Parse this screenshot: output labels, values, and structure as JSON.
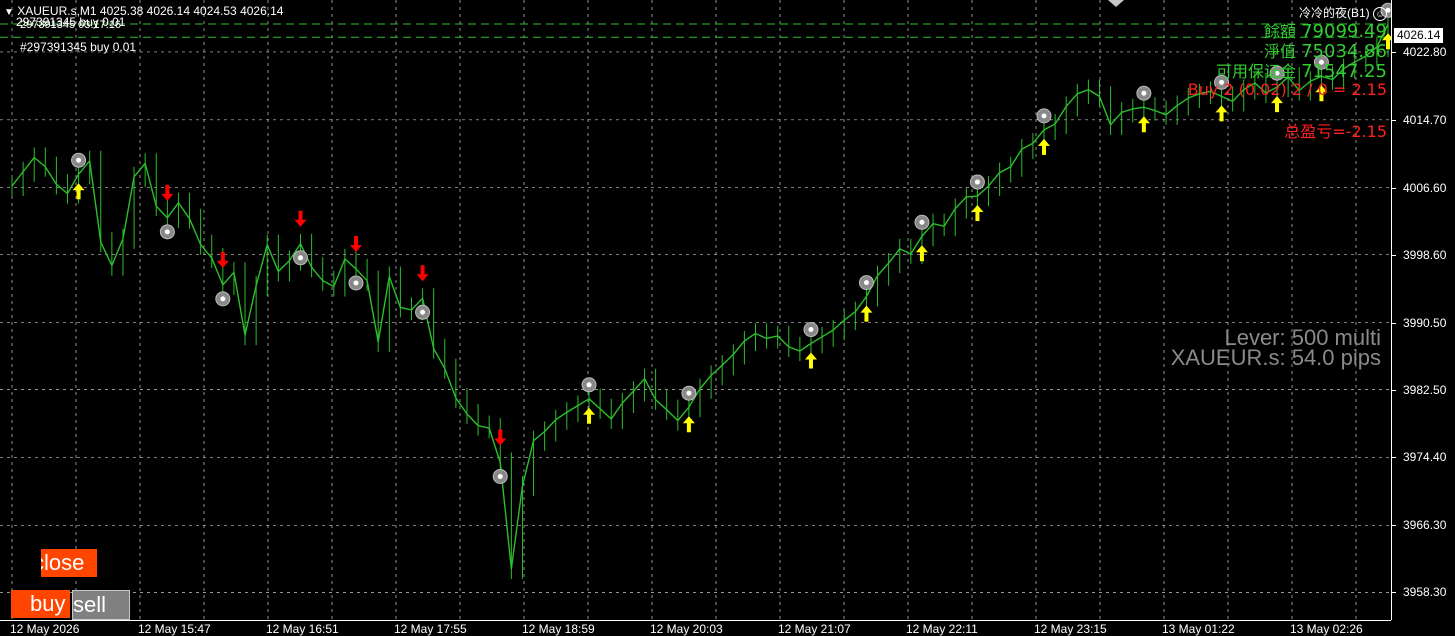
{
  "header": {
    "symbol_line": "XAUEUR.s,M1  4025.38 4026.14 4024.53 4026.14",
    "line2": "297391345 buy 0.01",
    "line2b": "297391345 03:17:16",
    "order_label": "#297391345 buy 0.01",
    "window_label": "冷冷的夜(B1)"
  },
  "account": {
    "balance_label": "餘額",
    "balance_value": "79099.49",
    "equity_label": "淨值",
    "equity_value": "75034.86",
    "free_margin_label": "可用保证金",
    "free_margin_value": "71547.25",
    "position_line": "Buy 2 (0.02) 2 / 0 = 2.15",
    "total_pnl": "总盈亏=-2.15"
  },
  "info": {
    "lever": "Lever: 500 multi",
    "spread": "XAUEUR.s: 54.0 pips"
  },
  "buttons": {
    "close": "close",
    "buy": "buy",
    "sell": "sell"
  },
  "price_axis": {
    "current_price": "4026.14",
    "ticks": [
      "4022.80",
      "4014.70",
      "4006.60",
      "3998.60",
      "3990.50",
      "3982.50",
      "3974.40",
      "3966.30",
      "3958.30"
    ]
  },
  "time_axis": {
    "ticks": [
      "12 May 2026",
      "12 May 15:47",
      "12 May 16:51",
      "12 May 17:55",
      "12 May 18:59",
      "12 May 20:03",
      "12 May 21:07",
      "12 May 22:11",
      "12 May 23:15",
      "13 May 01:22",
      "13 May 02:26"
    ]
  },
  "colors": {
    "background": "#000000",
    "grid": "#c8c8c8",
    "candles": "#2bbf2b",
    "up_arrow": "#ffff00",
    "down_arrow": "#ff0000",
    "level_line": "#2bbf2b",
    "account_text": "#32cd32",
    "loss_text": "#ff2020",
    "close_button": "#ff4500"
  },
  "chart_data": {
    "type": "line",
    "x_start": "12 May 2026",
    "x_end": "13 May 02:26",
    "ylim": [
      3955.0,
      4029.0
    ],
    "y_tick_values": [
      4022.8,
      4014.7,
      4006.6,
      3998.6,
      3990.5,
      3982.5,
      3974.4,
      3966.3,
      3958.3
    ],
    "series": [
      {
        "values": [
          4006.8,
          4008.5,
          4010.2,
          4009.1,
          4007.0,
          4005.9,
          4008.2,
          4009.8,
          4000.1,
          3997.3,
          4000.5,
          4007.9,
          4009.5,
          4004.4,
          4003.0,
          4004.8,
          4002.9,
          3999.8,
          3998.2,
          3995.0,
          3996.5,
          3989.0,
          3994.9,
          3999.8,
          3996.6,
          3997.9,
          3999.9,
          3997.1,
          3995.5,
          3994.8,
          3998.1,
          3996.9,
          3995.5,
          3988.2,
          3996.0,
          3992.3,
          3992.0,
          3993.4,
          3987.4,
          3985.0,
          3981.5,
          3979.6,
          3978.2,
          3977.9,
          3973.8,
          3961.1,
          3971.0,
          3976.4,
          3977.5,
          3978.9,
          3979.8,
          3980.6,
          3981.4,
          3980.2,
          3979.0,
          3980.9,
          3982.3,
          3983.8,
          3981.3,
          3980.1,
          3978.8,
          3980.4,
          3982.6,
          3984.2,
          3985.4,
          3986.7,
          3988.3,
          3989.2,
          3988.6,
          3988.9,
          3987.6,
          3987.1,
          3988.0,
          3988.8,
          3989.6,
          3990.8,
          3991.8,
          3993.6,
          3996.1,
          3997.6,
          3999.3,
          3998.7,
          4000.8,
          4002.3,
          4002.0,
          4004.1,
          4005.5,
          4005.6,
          4006.8,
          4008.4,
          4009.1,
          4011.2,
          4011.9,
          4013.5,
          4014.2,
          4016.3,
          4017.8,
          4018.3,
          4017.5,
          4014.1,
          4015.6,
          4016.0,
          4016.2,
          4015.8,
          4015.3,
          4016.4,
          4017.3,
          4017.8,
          4018.1,
          4017.5,
          4016.9,
          4018.3,
          4019.1,
          4017.9,
          4018.6,
          4019.8,
          4018.2,
          4019.3,
          4019.9,
          4019.5,
          4020.8,
          4021.6,
          4022.3,
          4023.4,
          4026.1
        ]
      }
    ],
    "buy_signal_bars": [
      6,
      52,
      61,
      72,
      77,
      82,
      87,
      93,
      102,
      109,
      114,
      118,
      124,
      129,
      134,
      138
    ],
    "sell_signal_bars": [
      14,
      19,
      26,
      31,
      37,
      44
    ],
    "level_lines": [
      4026.14,
      4024.55
    ]
  }
}
